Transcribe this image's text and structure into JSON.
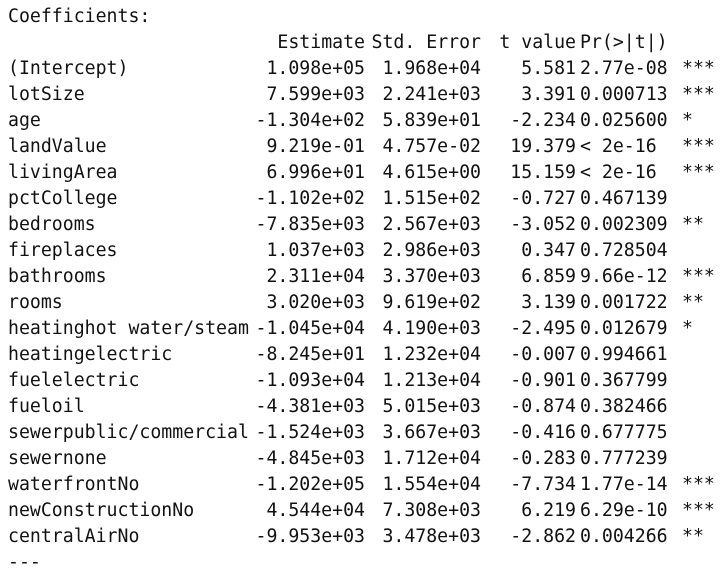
{
  "title": "Coefficients:",
  "columns": {
    "estimate": "Estimate",
    "std_error": "Std. Error",
    "t_value": "t value",
    "p_value": "Pr(>|t|)"
  },
  "rows": [
    {
      "name": "(Intercept)",
      "estimate": "1.098e+05",
      "std_error": "1.968e+04",
      "t_value": "5.581",
      "p_value": "2.77e-08",
      "sig": "***"
    },
    {
      "name": "lotSize",
      "estimate": "7.599e+03",
      "std_error": "2.241e+03",
      "t_value": "3.391",
      "p_value": "0.000713",
      "sig": "***"
    },
    {
      "name": "age",
      "estimate": "-1.304e+02",
      "std_error": "5.839e+01",
      "t_value": "-2.234",
      "p_value": "0.025600",
      "sig": "*"
    },
    {
      "name": "landValue",
      "estimate": "9.219e-01",
      "std_error": "4.757e-02",
      "t_value": "19.379",
      "p_value": "< 2e-16",
      "sig": "***"
    },
    {
      "name": "livingArea",
      "estimate": "6.996e+01",
      "std_error": "4.615e+00",
      "t_value": "15.159",
      "p_value": "< 2e-16",
      "sig": "***"
    },
    {
      "name": "pctCollege",
      "estimate": "-1.102e+02",
      "std_error": "1.515e+02",
      "t_value": "-0.727",
      "p_value": "0.467139",
      "sig": ""
    },
    {
      "name": "bedrooms",
      "estimate": "-7.835e+03",
      "std_error": "2.567e+03",
      "t_value": "-3.052",
      "p_value": "0.002309",
      "sig": "**"
    },
    {
      "name": "fireplaces",
      "estimate": "1.037e+03",
      "std_error": "2.986e+03",
      "t_value": "0.347",
      "p_value": "0.728504",
      "sig": ""
    },
    {
      "name": "bathrooms",
      "estimate": "2.311e+04",
      "std_error": "3.370e+03",
      "t_value": "6.859",
      "p_value": "9.66e-12",
      "sig": "***"
    },
    {
      "name": "rooms",
      "estimate": "3.020e+03",
      "std_error": "9.619e+02",
      "t_value": "3.139",
      "p_value": "0.001722",
      "sig": "**"
    },
    {
      "name": "heatinghot water/steam",
      "estimate": "-1.045e+04",
      "std_error": "4.190e+03",
      "t_value": "-2.495",
      "p_value": "0.012679",
      "sig": "*"
    },
    {
      "name": "heatingelectric",
      "estimate": "-8.245e+01",
      "std_error": "1.232e+04",
      "t_value": "-0.007",
      "p_value": "0.994661",
      "sig": ""
    },
    {
      "name": "fuelelectric",
      "estimate": "-1.093e+04",
      "std_error": "1.213e+04",
      "t_value": "-0.901",
      "p_value": "0.367799",
      "sig": ""
    },
    {
      "name": "fueloil",
      "estimate": "-4.381e+03",
      "std_error": "5.015e+03",
      "t_value": "-0.874",
      "p_value": "0.382466",
      "sig": ""
    },
    {
      "name": "sewerpublic/commercial",
      "estimate": "-1.524e+03",
      "std_error": "3.667e+03",
      "t_value": "-0.416",
      "p_value": "0.677775",
      "sig": ""
    },
    {
      "name": "sewernone",
      "estimate": "-4.845e+03",
      "std_error": "1.712e+04",
      "t_value": "-0.283",
      "p_value": "0.777239",
      "sig": ""
    },
    {
      "name": "waterfrontNo",
      "estimate": "-1.202e+05",
      "std_error": "1.554e+04",
      "t_value": "-7.734",
      "p_value": "1.77e-14",
      "sig": "***"
    },
    {
      "name": "newConstructionNo",
      "estimate": "4.544e+04",
      "std_error": "7.308e+03",
      "t_value": "6.219",
      "p_value": "6.29e-10",
      "sig": "***"
    },
    {
      "name": "centralAirNo",
      "estimate": "-9.953e+03",
      "std_error": "3.478e+03",
      "t_value": "-2.862",
      "p_value": "0.004266",
      "sig": "**"
    }
  ],
  "footer": "---"
}
